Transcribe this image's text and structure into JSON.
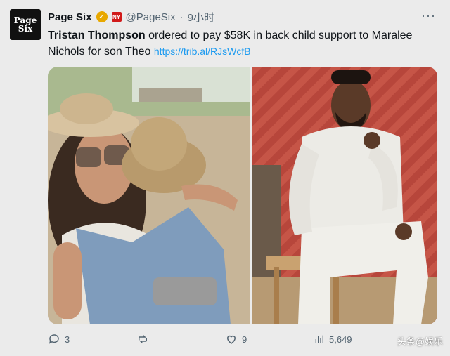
{
  "account": {
    "avatar_line1": "Page",
    "avatar_line2": "Six",
    "name": "Page Six",
    "handle": "@PageSix",
    "separator": "·",
    "time": "9小时"
  },
  "tweet": {
    "bold_text": "Tristan Thompson",
    "text": " ordered to pay $58K in back child support to Maralee Nichols for son Theo ",
    "link": "https://trib.al/RJsWcfB"
  },
  "actions": {
    "replies": "3",
    "reposts": "",
    "likes": "9",
    "views": "5,649"
  },
  "watermark": "头条@娱乐",
  "icons": {
    "verified": "verified-badge-icon",
    "affiliate": "affiliate-badge-icon",
    "more": "more-icon",
    "reply": "reply-icon",
    "repost": "repost-icon",
    "like": "like-icon",
    "views": "views-icon"
  },
  "colors": {
    "link": "#1d9bf0",
    "verified": "#e8a800",
    "muted": "#536471"
  }
}
